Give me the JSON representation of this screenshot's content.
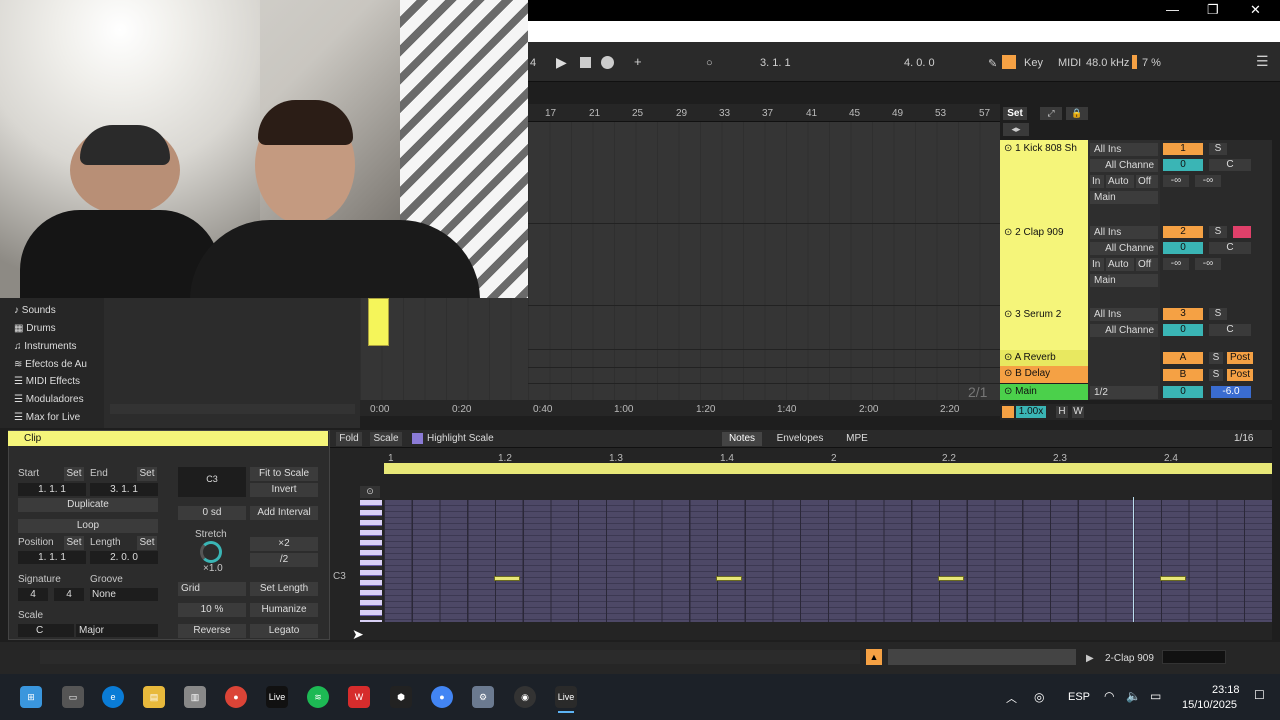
{
  "window": {
    "minimize": "—",
    "restore": "❐",
    "close": "✕"
  },
  "transport": {
    "position": "3. 1. 1",
    "loop_length": "4. 0. 0",
    "key_label": "Key",
    "midi_label": "MIDI",
    "sample_rate": "48.0 kHz",
    "cpu": "7 %",
    "left_num": "4"
  },
  "arrangement": {
    "bar_markers": [
      "17",
      "21",
      "25",
      "29",
      "33",
      "37",
      "41",
      "45",
      "49",
      "53",
      "57"
    ],
    "set_label": "Set",
    "time_markers": [
      "0:00",
      "0:20",
      "0:40",
      "1:00",
      "1:20",
      "1:40",
      "2:00",
      "2:20"
    ],
    "zoom_ratio": "2/1"
  },
  "tracks": [
    {
      "name": "1 Kick 808 Sh",
      "input": "All Ins",
      "channel": "All Channe",
      "monitor": [
        "In",
        "Auto",
        "Off"
      ],
      "output": "Main",
      "number": "1",
      "solo": "S",
      "vol": "0",
      "pan": "C",
      "sends": [
        "-∞",
        "-∞"
      ],
      "color": "#f5f57a"
    },
    {
      "name": "2 Clap 909",
      "input": "All Ins",
      "channel": "All Channe",
      "monitor": [
        "In",
        "Auto",
        "Off"
      ],
      "output": "Main",
      "number": "2",
      "solo": "S",
      "vol": "0",
      "pan": "C",
      "sends": [
        "-∞",
        "-∞"
      ],
      "color": "#f5f57a"
    },
    {
      "name": "3 Serum 2",
      "input": "All Ins",
      "channel": "All Channe",
      "number": "3",
      "solo": "S",
      "vol": "0",
      "pan": "C",
      "color": "#f5f57a"
    }
  ],
  "returns": [
    {
      "name": "A Reverb",
      "letter": "A",
      "solo": "S",
      "post": "Post",
      "color": "#e8e860"
    },
    {
      "name": "B Delay",
      "letter": "B",
      "solo": "S",
      "post": "Post",
      "color": "#f5a144"
    }
  ],
  "master": {
    "name": "Main",
    "ratio": "1/2",
    "vol": "0",
    "db": "-6.0",
    "tempo_mult": "1.00x",
    "h": "H",
    "w": "W"
  },
  "browser": {
    "items": [
      "Sounds",
      "Drums",
      "Instruments",
      "Efectos de Au",
      "MIDI Effects",
      "Moduladores",
      "Max for Live"
    ]
  },
  "clip": {
    "title": "Clip",
    "start_label": "Start",
    "set": "Set",
    "end_label": "End",
    "start_value": "1. 1. 1",
    "end_value": "3. 1. 1",
    "duplicate": "Duplicate",
    "loop": "Loop",
    "position_label": "Position",
    "length_label": "Length",
    "position_value": "1. 1. 1",
    "length_value": "2. 0. 0",
    "signature_label": "Signature",
    "sig_num": "4",
    "sig_den": "4",
    "groove_label": "Groove",
    "groove_value": "None",
    "scale_label": "Scale",
    "scale_root": "C",
    "scale_mode": "Major",
    "note_box": "C3",
    "fit_to_scale": "Fit to Scale",
    "invert": "Invert",
    "semitones": "0 sd",
    "add_interval": "Add Interval",
    "stretch_label": "Stretch",
    "stretch_value": "×1.0",
    "x2": "×2",
    "div2": "/2",
    "grid": "Grid",
    "set_length": "Set Length",
    "percent": "10 %",
    "humanize": "Humanize",
    "reverse": "Reverse",
    "legato": "Legato"
  },
  "piano_roll": {
    "fold": "Fold",
    "scale": "Scale",
    "highlight": "Highlight Scale",
    "tabs": [
      "Notes",
      "Envelopes",
      "MPE"
    ],
    "grid": "1/16",
    "ruler": [
      "1",
      "1.2",
      "1.3",
      "1.4",
      "2",
      "2.2",
      "2.3",
      "2.4"
    ],
    "c3": "C3"
  },
  "status": {
    "track_name": "2-Clap 909"
  },
  "taskbar": {
    "lang": "ESP",
    "time": "23:18",
    "date": "15/10/2025",
    "live": "Live"
  }
}
